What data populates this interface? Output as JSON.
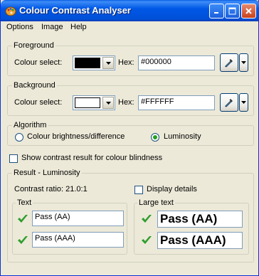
{
  "window": {
    "title": "Colour Contrast Analyser"
  },
  "menu": [
    {
      "label": "Options"
    },
    {
      "label": "Image"
    },
    {
      "label": "Help"
    }
  ],
  "foreground": {
    "group_label": "Foreground",
    "colour_select_label": "Colour select:",
    "swatch_color": "#000000",
    "hex_label": "Hex:",
    "hex_value": "#000000"
  },
  "background": {
    "group_label": "Background",
    "colour_select_label": "Colour select:",
    "swatch_color": "#FFFFFF",
    "hex_label": "Hex:",
    "hex_value": "#FFFFFF"
  },
  "algorithm": {
    "group_label": "Algorithm",
    "options": [
      {
        "label": "Colour brightness/difference",
        "selected": false
      },
      {
        "label": "Luminosity",
        "selected": true
      }
    ]
  },
  "colour_blindness": {
    "label": "Show contrast result for colour blindness",
    "checked": false
  },
  "result": {
    "group_label": "Result - Luminosity",
    "contrast_ratio": "Contrast ratio: 21.0:1",
    "display_details": {
      "label": "Display details",
      "checked": false
    },
    "text": {
      "label": "Text",
      "rows": [
        {
          "value": "Pass (AA)"
        },
        {
          "value": "Pass (AAA)"
        }
      ]
    },
    "large_text": {
      "label": "Large text",
      "rows": [
        {
          "value": "Pass (AA)"
        },
        {
          "value": "Pass (AAA)"
        }
      ]
    }
  },
  "icons": {
    "app": "palette-icon",
    "picker": "eyedropper-icon",
    "pass": "checkmark-icon"
  },
  "colors": {
    "titlebar": "#0058E6",
    "face": "#ECE9D8",
    "pass_check": "#2E9E2E"
  }
}
